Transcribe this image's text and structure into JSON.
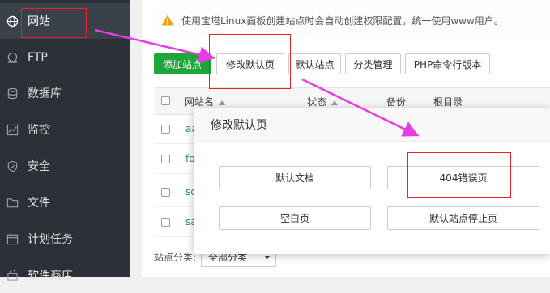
{
  "sidebar": {
    "items": [
      {
        "label": "网站",
        "icon": "globe-icon",
        "active": true
      },
      {
        "label": "FTP",
        "icon": "ftp-icon"
      },
      {
        "label": "数据库",
        "icon": "database-icon"
      },
      {
        "label": "监控",
        "icon": "monitor-icon"
      },
      {
        "label": "安全",
        "icon": "shield-icon"
      },
      {
        "label": "文件",
        "icon": "folder-icon"
      },
      {
        "label": "计划任务",
        "icon": "calendar-icon"
      },
      {
        "label": "软件商店",
        "icon": "store-icon"
      }
    ]
  },
  "notice": {
    "text": "使用宝塔Linux面板创建站点时会自动创建权限配置，统一使用www用户。",
    "icon": "warning-icon"
  },
  "toolbar": {
    "add_site": "添加站点",
    "modify_default_page": "修改默认页",
    "default_site": "默认站点",
    "category_manage": "分类管理",
    "php_cli_version": "PHP命令行版本"
  },
  "table": {
    "headers": {
      "site_name": "网站名",
      "status": "状态",
      "backup": "备份",
      "root_dir": "根目录"
    },
    "rows": [
      {
        "name": "aa"
      },
      {
        "name": "fo"
      },
      {
        "name": "sc"
      },
      {
        "name": "sa"
      }
    ]
  },
  "filter": {
    "label": "站点分类:",
    "selected": "全部分类"
  },
  "dialog": {
    "title": "修改默认页",
    "buttons": {
      "default_doc": "默认文档",
      "error_404": "404错误页",
      "blank_page": "空白页",
      "default_site_stopped": "默认站点停止页"
    }
  },
  "colors": {
    "sidebar_bg": "#2c3138",
    "brand_green": "#20a53a",
    "highlight_red": "#e5212b",
    "arrow_magenta": "#e63ce6",
    "warning_orange": "#f0a020"
  }
}
